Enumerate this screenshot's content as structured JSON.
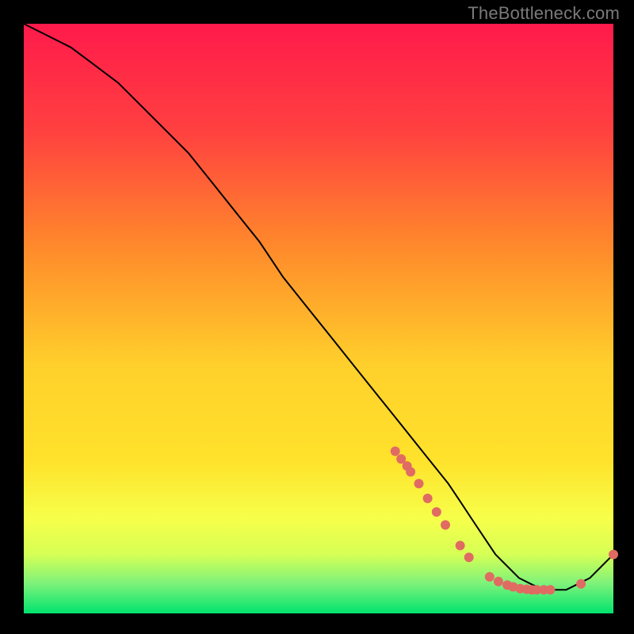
{
  "watermark": "TheBottleneck.com",
  "chart_data": {
    "type": "line",
    "title": "",
    "xlabel": "",
    "ylabel": "",
    "xlim": [
      0,
      100
    ],
    "ylim": [
      0,
      100
    ],
    "grid": false,
    "background_gradient": {
      "top": "#ff1a4b",
      "upper_mid": "#ff8a2b",
      "mid": "#ffe22b",
      "lower": "#f6ff4a",
      "bottom": "#00e36e"
    },
    "series": [
      {
        "name": "bottleneck-curve",
        "x": [
          0,
          4,
          8,
          12,
          16,
          20,
          24,
          28,
          32,
          36,
          40,
          44,
          48,
          52,
          56,
          60,
          64,
          68,
          72,
          74,
          76,
          78,
          80,
          82,
          84,
          86,
          88,
          90,
          92,
          94,
          96,
          98,
          100
        ],
        "y": [
          100,
          98,
          96,
          93,
          90,
          86,
          82,
          78,
          73,
          68,
          63,
          57,
          52,
          47,
          42,
          37,
          32,
          27,
          22,
          19,
          16,
          13,
          10,
          8,
          6,
          5,
          4,
          4,
          4,
          5,
          6,
          8,
          10
        ]
      }
    ],
    "points": {
      "name": "highlight-markers",
      "color": "#e06b63",
      "radius": 6,
      "xy": [
        [
          63,
          27.5
        ],
        [
          64,
          26.2
        ],
        [
          65,
          25.0
        ],
        [
          65.6,
          24.0
        ],
        [
          67,
          22.0
        ],
        [
          68.5,
          19.5
        ],
        [
          70,
          17.2
        ],
        [
          71.5,
          15.0
        ],
        [
          74,
          11.5
        ],
        [
          75.5,
          9.5
        ],
        [
          79,
          6.2
        ],
        [
          80.5,
          5.4
        ],
        [
          82,
          4.8
        ],
        [
          83,
          4.5
        ],
        [
          84.2,
          4.2
        ],
        [
          85.3,
          4.1
        ],
        [
          86.2,
          4.0
        ],
        [
          87.0,
          4.0
        ],
        [
          88.2,
          4.0
        ],
        [
          89.3,
          4.0
        ],
        [
          94.5,
          5.0
        ],
        [
          100,
          10
        ]
      ]
    }
  }
}
